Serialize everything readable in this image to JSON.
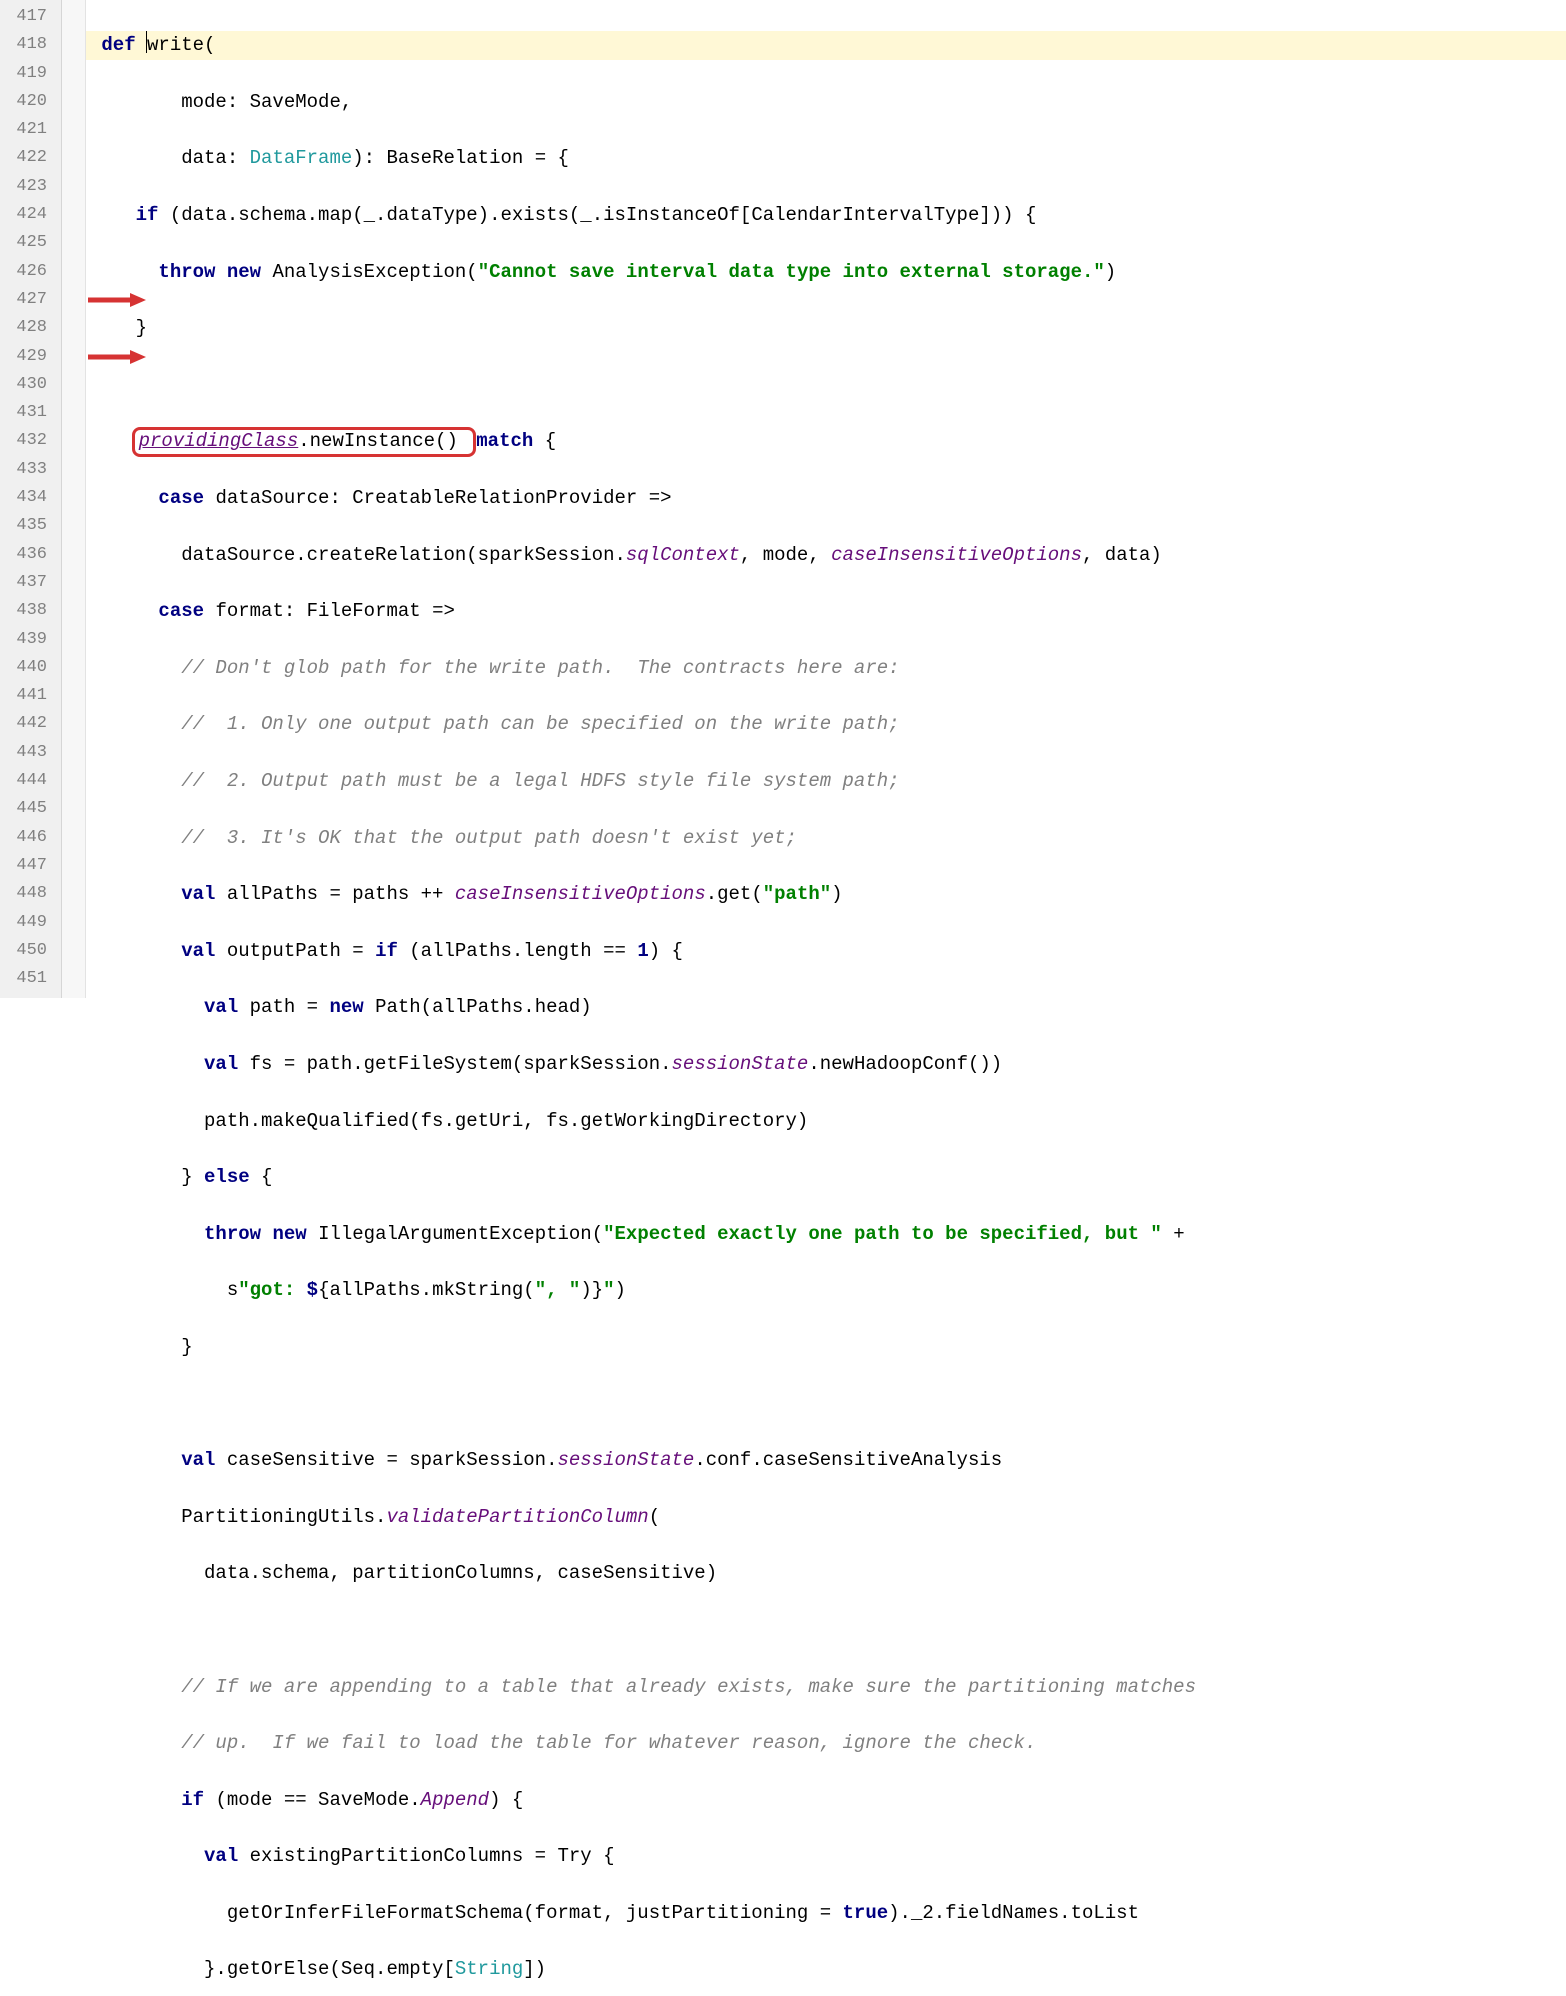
{
  "lineNumbers": [
    "417",
    "418",
    "419",
    "420",
    "421",
    "422",
    "423",
    "424",
    "425",
    "426",
    "427",
    "428",
    "429",
    "430",
    "431",
    "432",
    "433",
    "434",
    "435",
    "436",
    "437",
    "438",
    "439",
    "440",
    "441",
    "442",
    "443",
    "444",
    "445",
    "446",
    "447",
    "448",
    "449",
    "450",
    "451"
  ],
  "code": {
    "l417_kw": "def ",
    "l417_name": "write(",
    "l418": "        mode: SaveMode,",
    "l419_a": "        data: ",
    "l419_type": "DataFrame",
    "l419_b": "): BaseRelation = {",
    "l420_a": "    ",
    "l420_kw": "if ",
    "l420_b": "(data.schema.map(_.dataType).exists(_.isInstanceOf[CalendarIntervalType])) {",
    "l421_a": "      ",
    "l421_kw": "throw new ",
    "l421_b": "AnalysisException(",
    "l421_str": "\"Cannot save interval data type into external storage.\"",
    "l421_c": ")",
    "l422": "    }",
    "l424_box": "providingClass",
    "l424_box2": ".newInstance() ",
    "l424_kw": "match ",
    "l424_c": "{",
    "l425_a": "      ",
    "l425_kw": "case ",
    "l425_b": "dataSource: CreatableRelationProvider =>",
    "l426_a": "        dataSource.createRelation(sparkSession.",
    "l426_f1": "sqlContext",
    "l426_b": ", mode, ",
    "l426_f2": "caseInsensitiveOptions",
    "l426_c": ", data)",
    "l427_a": "      ",
    "l427_kw": "case ",
    "l427_b": "format: FileFormat =>",
    "l428": "        // Don't glob path for the write path.  The contracts here are:",
    "l429": "        //  1. Only one output path can be specified on the write path;",
    "l430": "        //  2. Output path must be a legal HDFS style file system path;",
    "l431": "        //  3. It's OK that the output path doesn't exist yet;",
    "l432_a": "        ",
    "l432_kw": "val ",
    "l432_b": "allPaths = paths ++ ",
    "l432_f": "caseInsensitiveOptions",
    "l432_c": ".get(",
    "l432_str": "\"path\"",
    "l432_d": ")",
    "l433_a": "        ",
    "l433_kw": "val ",
    "l433_b": "outputPath = ",
    "l433_kw2": "if ",
    "l433_c": "(allPaths.length == ",
    "l433_num": "1",
    "l433_d": ") {",
    "l434_a": "          ",
    "l434_kw": "val ",
    "l434_b": "path = ",
    "l434_kw2": "new ",
    "l434_c": "Path(allPaths.head)",
    "l435_a": "          ",
    "l435_kw": "val ",
    "l435_b": "fs = path.getFileSystem(sparkSession.",
    "l435_f": "sessionState",
    "l435_c": ".newHadoopConf())",
    "l436": "          path.makeQualified(fs.getUri, fs.getWorkingDirectory)",
    "l437_a": "        } ",
    "l437_kw": "else ",
    "l437_b": "{",
    "l438_a": "          ",
    "l438_kw": "throw new ",
    "l438_b": "IllegalArgumentException(",
    "l438_str": "\"Expected exactly one path to be specified, but \"",
    "l438_c": " +",
    "l439_a": "            s",
    "l439_str1": "\"got: ",
    "l439_interp": "$",
    "l439_b": "{allPaths.mkString(",
    "l439_str2": "\", \"",
    "l439_c": ")}",
    "l439_str3": "\"",
    "l439_d": ")",
    "l440": "        }",
    "l442_a": "        ",
    "l442_kw": "val ",
    "l442_b": "caseSensitive = sparkSession.",
    "l442_f": "sessionState",
    "l442_c": ".conf.caseSensitiveAnalysis",
    "l443_a": "        PartitioningUtils.",
    "l443_f": "validatePartitionColumn",
    "l443_b": "(",
    "l444": "          data.schema, partitionColumns, caseSensitive)",
    "l446": "        // If we are appending to a table that already exists, make sure the partitioning matches",
    "l447": "        // up.  If we fail to load the table for whatever reason, ignore the check.",
    "l448_a": "        ",
    "l448_kw": "if ",
    "l448_b": "(mode == SaveMode.",
    "l448_f": "Append",
    "l448_c": ") {",
    "l449_a": "          ",
    "l449_kw": "val ",
    "l449_b": "existingPartitionColumns = Try {",
    "l450_a": "            getOrInferFileFormatSchema(format, justPartitioning = ",
    "l450_kw": "true",
    "l450_b": ")._2.fieldNames.toList",
    "l451_a": "          }.getOrElse(Seq.empty[",
    "l451_t": "String",
    "l451_b": "])"
  },
  "annotations": {
    "highlighted_text": "providingClass.newInstance()",
    "arrow_lines": [
      425,
      427
    ]
  }
}
